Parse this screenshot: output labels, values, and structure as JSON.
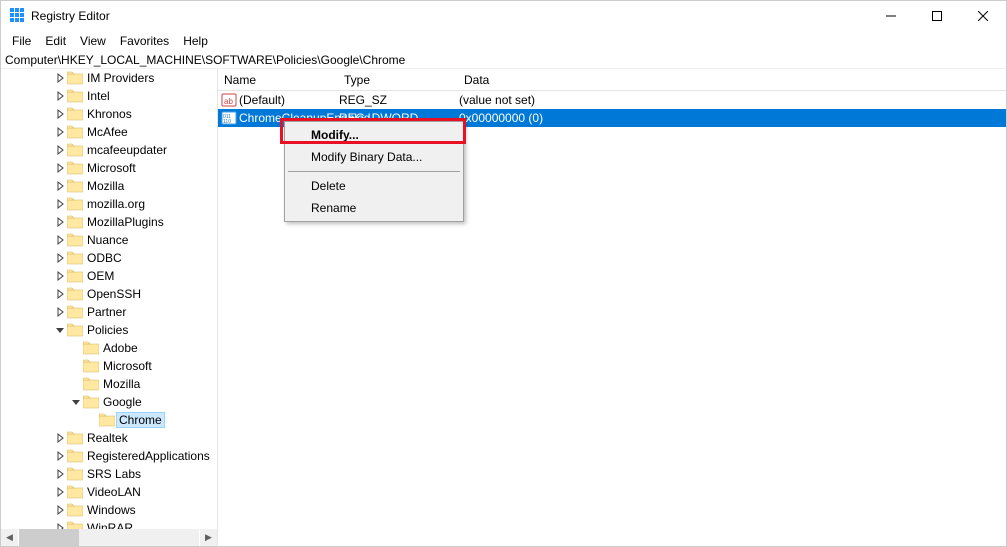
{
  "window": {
    "title": "Registry Editor"
  },
  "menu": {
    "file": "File",
    "edit": "Edit",
    "view": "View",
    "favorites": "Favorites",
    "help": "Help"
  },
  "address": "Computer\\HKEY_LOCAL_MACHINE\\SOFTWARE\\Policies\\Google\\Chrome",
  "tree": [
    {
      "label": "IM Providers",
      "depth": 3,
      "exp": "closed"
    },
    {
      "label": "Intel",
      "depth": 3,
      "exp": "closed"
    },
    {
      "label": "Khronos",
      "depth": 3,
      "exp": "closed"
    },
    {
      "label": "McAfee",
      "depth": 3,
      "exp": "closed"
    },
    {
      "label": "mcafeeupdater",
      "depth": 3,
      "exp": "closed"
    },
    {
      "label": "Microsoft",
      "depth": 3,
      "exp": "closed"
    },
    {
      "label": "Mozilla",
      "depth": 3,
      "exp": "closed"
    },
    {
      "label": "mozilla.org",
      "depth": 3,
      "exp": "closed"
    },
    {
      "label": "MozillaPlugins",
      "depth": 3,
      "exp": "closed"
    },
    {
      "label": "Nuance",
      "depth": 3,
      "exp": "closed"
    },
    {
      "label": "ODBC",
      "depth": 3,
      "exp": "closed"
    },
    {
      "label": "OEM",
      "depth": 3,
      "exp": "closed"
    },
    {
      "label": "OpenSSH",
      "depth": 3,
      "exp": "closed"
    },
    {
      "label": "Partner",
      "depth": 3,
      "exp": "closed"
    },
    {
      "label": "Policies",
      "depth": 3,
      "exp": "open"
    },
    {
      "label": "Adobe",
      "depth": 4,
      "exp": "none"
    },
    {
      "label": "Microsoft",
      "depth": 4,
      "exp": "none"
    },
    {
      "label": "Mozilla",
      "depth": 4,
      "exp": "none"
    },
    {
      "label": "Google",
      "depth": 4,
      "exp": "open"
    },
    {
      "label": "Chrome",
      "depth": 5,
      "exp": "none",
      "sel": true
    },
    {
      "label": "Realtek",
      "depth": 3,
      "exp": "closed"
    },
    {
      "label": "RegisteredApplications",
      "depth": 3,
      "exp": "closed"
    },
    {
      "label": "SRS Labs",
      "depth": 3,
      "exp": "closed"
    },
    {
      "label": "VideoLAN",
      "depth": 3,
      "exp": "closed"
    },
    {
      "label": "Windows",
      "depth": 3,
      "exp": "closed"
    },
    {
      "label": "WinRAR",
      "depth": 3,
      "exp": "closed"
    }
  ],
  "list": {
    "headers": {
      "name": "Name",
      "type": "Type",
      "data": "Data"
    },
    "rows": [
      {
        "name": "(Default)",
        "type": "REG_SZ",
        "data": "(value not set)",
        "kind": "string",
        "sel": false
      },
      {
        "name": "ChromeCleanupEnabled",
        "type": "REG_DWORD",
        "data": "0x00000000 (0)",
        "kind": "dword",
        "sel": true
      }
    ]
  },
  "context": {
    "modify": "Modify...",
    "modifybin": "Modify Binary Data...",
    "delete": "Delete",
    "rename": "Rename"
  }
}
